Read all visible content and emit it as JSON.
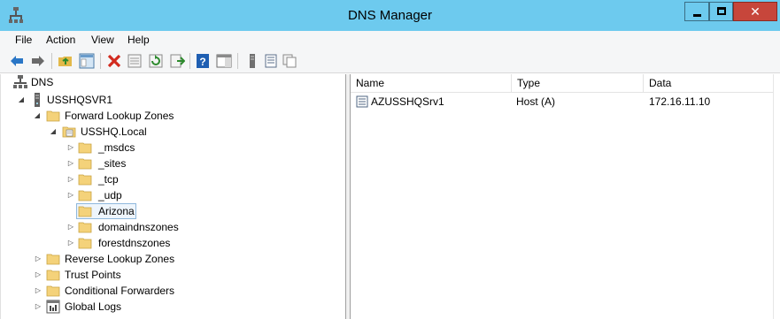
{
  "window": {
    "title": "DNS Manager",
    "minimize_glyph": "",
    "close_glyph": "✕"
  },
  "menu": {
    "items": [
      "File",
      "Action",
      "View",
      "Help"
    ]
  },
  "toolbar": {
    "icons": [
      "back-arrow-icon",
      "forward-arrow-icon",
      "up-folder-icon",
      "show-hide-tree-icon",
      "delete-icon",
      "properties-icon",
      "refresh-icon",
      "export-list-icon",
      "help-icon",
      "show-hide-action-pane-icon",
      "server-icon",
      "records-icon",
      "copy-icon"
    ]
  },
  "tree": {
    "root": {
      "label": "DNS",
      "icon": "dns-icon"
    },
    "server": {
      "label": "USSHQSVR1",
      "icon": "server-icon"
    },
    "forward_zones": {
      "label": "Forward Lookup Zones"
    },
    "zone": {
      "label": "USSHQ.Local"
    },
    "subfolders": [
      {
        "label": "_msdcs",
        "expandable": true
      },
      {
        "label": "_sites",
        "expandable": true
      },
      {
        "label": "_tcp",
        "expandable": true
      },
      {
        "label": "_udp",
        "expandable": true
      },
      {
        "label": "Arizona",
        "expandable": false,
        "selected": true
      },
      {
        "label": "domaindnszones",
        "expandable": true
      },
      {
        "label": "forestdnszones",
        "expandable": true
      }
    ],
    "top_nodes": [
      {
        "label": "Reverse Lookup Zones",
        "icon": "folder-icon"
      },
      {
        "label": "Trust Points",
        "icon": "folder-icon"
      },
      {
        "label": "Conditional Forwarders",
        "icon": "folder-icon"
      },
      {
        "label": "Global Logs",
        "icon": "log-icon"
      }
    ]
  },
  "list": {
    "columns": [
      "Name",
      "Type",
      "Data"
    ],
    "rows": [
      {
        "name": "AZUSSHQSrv1",
        "type": "Host (A)",
        "data": "172.16.11.10"
      }
    ]
  },
  "colors": {
    "titlebar": "#6dcaee",
    "close_button": "#c7463b",
    "selection_border": "#8fb8dc",
    "folder": "#f4d27a"
  }
}
